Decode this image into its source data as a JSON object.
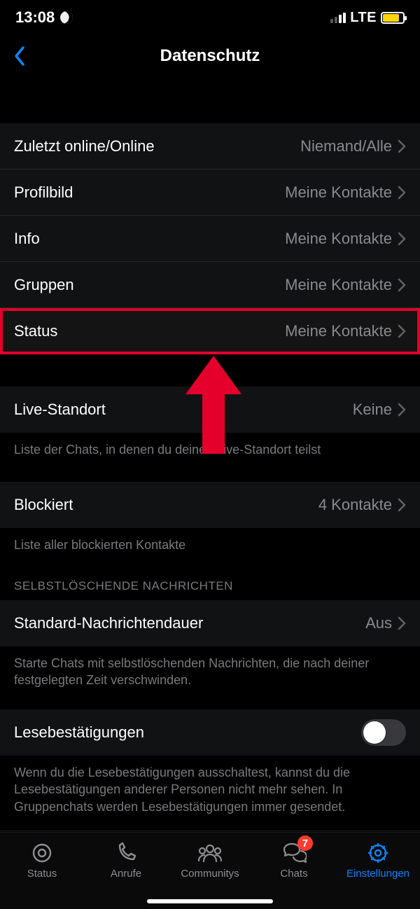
{
  "status_bar": {
    "time": "13:08",
    "network": "LTE"
  },
  "header": {
    "title": "Datenschutz"
  },
  "section1": {
    "rows": [
      {
        "label": "Zuletzt online/Online",
        "value": "Niemand/Alle"
      },
      {
        "label": "Profilbild",
        "value": "Meine Kontakte"
      },
      {
        "label": "Info",
        "value": "Meine Kontakte"
      },
      {
        "label": "Gruppen",
        "value": "Meine Kontakte"
      },
      {
        "label": "Status",
        "value": "Meine Kontakte"
      }
    ]
  },
  "section_live": {
    "label": "Live-Standort",
    "value": "Keine",
    "footer": "Liste der Chats, in denen du deinen Live-Standort teilst"
  },
  "section_blocked": {
    "label": "Blockiert",
    "value": "4 Kontakte",
    "footer": "Liste aller blockierten Kontakte"
  },
  "section_disappearing": {
    "header": "SELBSTLÖSCHENDE NACHRICHTEN",
    "label": "Standard-Nachrichtendauer",
    "value": "Aus",
    "footer": "Starte Chats mit selbstlöschenden Nachrichten, die nach deiner festgelegten Zeit verschwinden."
  },
  "section_receipts": {
    "label": "Lesebestätigungen",
    "on": false,
    "footer": "Wenn du die Lesebestätigungen ausschaltest, kannst du die Lesebestätigungen anderer Personen nicht mehr sehen. In Gruppenchats werden Lesebestätigungen immer gesendet."
  },
  "tabs": {
    "status": "Status",
    "calls": "Anrufe",
    "communities": "Communitys",
    "chats": "Chats",
    "chats_badge": "7",
    "settings": "Einstellungen"
  }
}
